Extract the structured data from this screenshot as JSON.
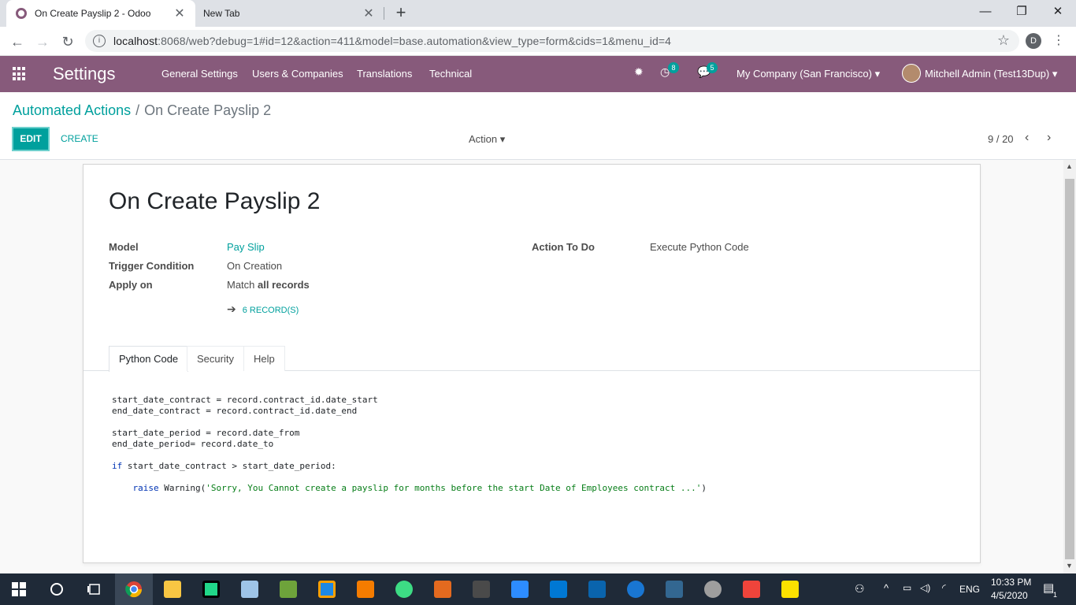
{
  "browser": {
    "tabs": [
      {
        "title": "On Create Payslip 2 - Odoo",
        "active": true
      },
      {
        "title": "New Tab",
        "active": false
      }
    ],
    "url_host": "localhost",
    "url_rest": ":8068/web?debug=1#id=12&action=411&model=base.automation&view_type=form&cids=1&menu_id=4",
    "profile_initial": "D"
  },
  "navbar": {
    "brand": "Settings",
    "menus": [
      "General Settings",
      "Users & Companies",
      "Translations",
      "Technical"
    ],
    "activity_count": "8",
    "message_count": "5",
    "company": "My Company (San Francisco)",
    "user": "Mitchell Admin (Test13Dup)"
  },
  "control_panel": {
    "breadcrumb_parent": "Automated Actions",
    "breadcrumb_divider": "/",
    "breadcrumb_current": "On Create Payslip 2",
    "edit_label": "EDIT",
    "create_label": "CREATE",
    "action_label": "Action",
    "pager": "9 / 20"
  },
  "form": {
    "title": "On Create Payslip 2",
    "model_label": "Model",
    "model_value": "Pay Slip",
    "trigger_label": "Trigger Condition",
    "trigger_value": "On Creation",
    "apply_label": "Apply on",
    "apply_prefix": "Match",
    "apply_value": "all records",
    "action_label": "Action To Do",
    "action_value": "Execute Python Code",
    "records_button": "6 RECORD(S)",
    "tabs": [
      "Python Code",
      "Security",
      "Help"
    ],
    "code_lines": [
      "start_date_contract = record.contract_id.date_start",
      "end_date_contract = record.contract_id.date_end",
      "",
      "start_date_period = record.date_from",
      "end_date_period= record.date_to",
      "",
      "if start_date_contract > start_date_period:",
      "",
      "    raise Warning('Sorry, You Cannot create a payslip for months before the start Date of Employees contract ...')"
    ]
  },
  "taskbar": {
    "time": "10:33 PM",
    "date": "4/5/2020",
    "language": "ENG",
    "notification_count": "1"
  },
  "colors": {
    "odoo_purple": "#875a7b",
    "teal": "#00a09d"
  }
}
